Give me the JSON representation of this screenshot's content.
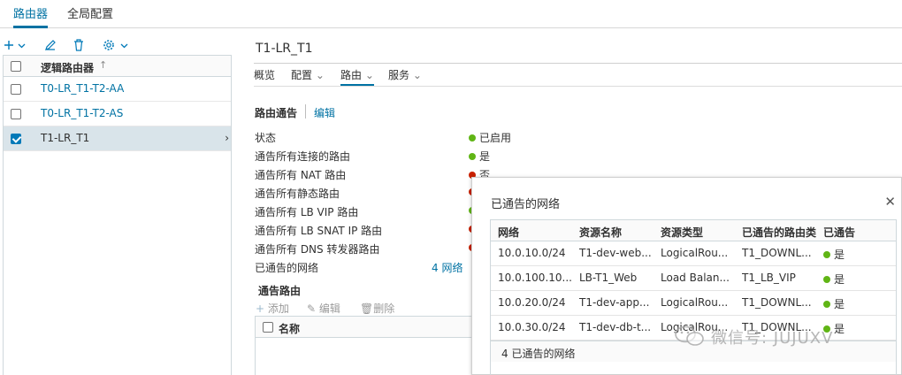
{
  "top_tabs": [
    {
      "label": "路由器",
      "active": true
    },
    {
      "label": "全局配置",
      "active": false
    }
  ],
  "toolbar": {
    "add_icon": "plus-icon",
    "add_caret": "chevron-down-icon",
    "edit_icon": "pencil-icon",
    "delete_icon": "trash-icon",
    "settings_icon": "gear-icon",
    "settings_caret": "chevron-down-icon"
  },
  "router_grid": {
    "column_header": "逻辑路由器",
    "sort_icon": "arrow-up-icon",
    "rows": [
      {
        "name": "T0-LR_T1-T2-AA",
        "checked": false,
        "selected": false
      },
      {
        "name": "T0-LR_T1-T2-AS",
        "checked": false,
        "selected": false
      },
      {
        "name": "T1-LR_T1",
        "checked": true,
        "selected": true
      }
    ]
  },
  "detail": {
    "title": "T1-LR_T1",
    "tabs": [
      {
        "label": "概览",
        "caret": false,
        "active": false
      },
      {
        "label": "配置",
        "caret": true,
        "active": false
      },
      {
        "label": "路由",
        "caret": true,
        "active": true
      },
      {
        "label": "服务",
        "caret": true,
        "active": false
      }
    ],
    "section_title": "路由通告",
    "edit_label": "编辑",
    "properties": [
      {
        "label": "状态",
        "value": "已启用",
        "status": "green"
      },
      {
        "label": "通告所有连接的路由",
        "value": "是",
        "status": "green"
      },
      {
        "label": "通告所有 NAT 路由",
        "value": "否",
        "status": "red"
      },
      {
        "label": "通告所有静态路由",
        "value": "",
        "status": "red"
      },
      {
        "label": "通告所有 LB VIP 路由",
        "value": "",
        "status": "green"
      },
      {
        "label": "通告所有 LB SNAT IP 路由",
        "value": "",
        "status": "red"
      },
      {
        "label": "通告所有 DNS 转发器路由",
        "value": "",
        "status": "red"
      }
    ],
    "advertised_networks_label": "已通告的网络",
    "advertised_networks_link": "4 网络",
    "routes_title": "通告路由",
    "actions": {
      "add": "添加",
      "edit": "编辑",
      "delete": "删除"
    },
    "routes_column": "名称"
  },
  "popover": {
    "title": "已通告的网络",
    "close_icon": "close-icon",
    "columns": [
      "网络",
      "资源名称",
      "资源类型",
      "已通告的路由类",
      "已通告"
    ],
    "rows": [
      {
        "network": "10.0.10.0/24",
        "resource_name": "T1-dev-web...",
        "resource_type": "LogicalRou...",
        "route_type": "T1_DOWNL...",
        "advertised": "是"
      },
      {
        "network": "10.0.100.10...",
        "resource_name": "LB-T1_Web",
        "resource_type": "Load Balan...",
        "route_type": "T1_LB_VIP",
        "advertised": "是"
      },
      {
        "network": "10.0.20.0/24",
        "resource_name": "T1-dev-app...",
        "resource_type": "LogicalRou...",
        "route_type": "T1_DOWNL...",
        "advertised": "是"
      },
      {
        "network": "10.0.30.0/24",
        "resource_name": "T1-dev-db-t...",
        "resource_type": "LogicalRou...",
        "route_type": "T1_DOWNL...",
        "advertised": "是"
      }
    ],
    "footer": "4 已通告的网络"
  },
  "watermark": {
    "text": "微信号: JUJUXV"
  },
  "colors": {
    "accent": "#0072a3",
    "green": "#60b515",
    "red": "#c92100"
  }
}
